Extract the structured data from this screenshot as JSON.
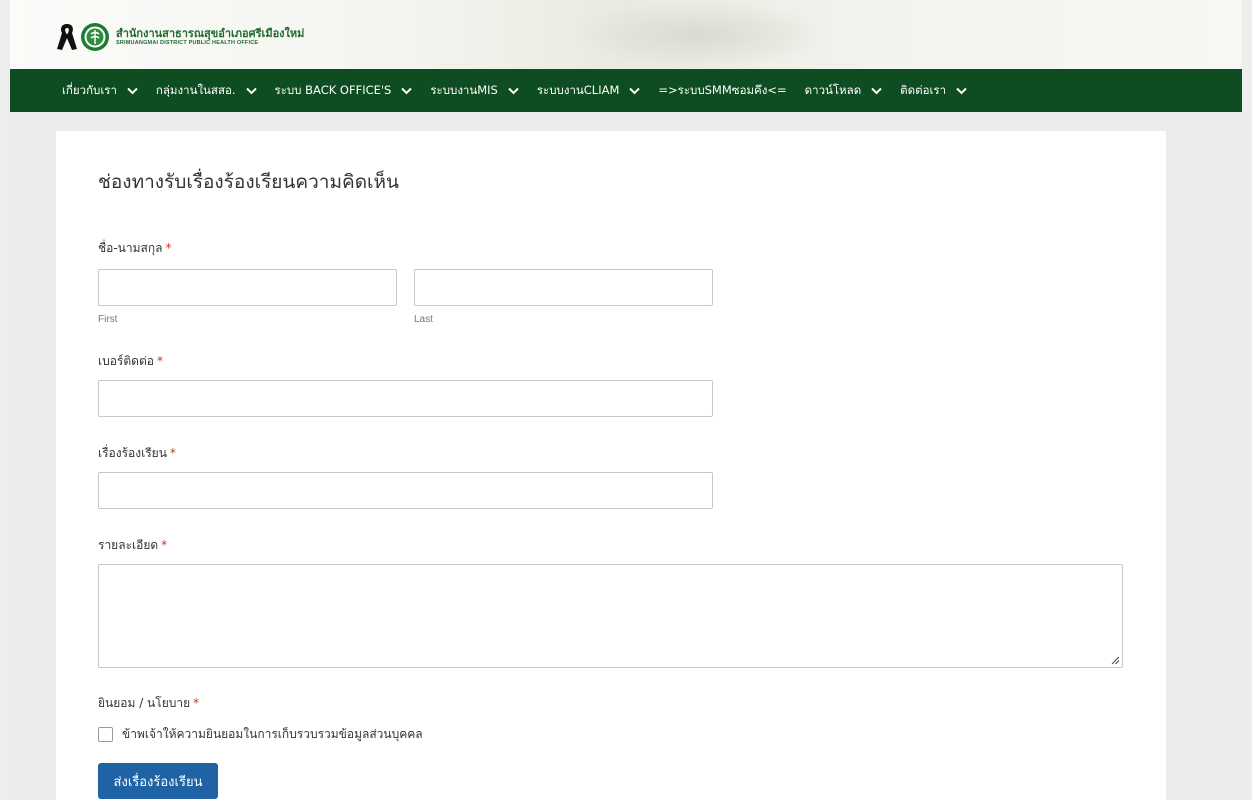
{
  "header": {
    "org_name_th": "สำนักงานสาธารณสุขอำเภอศรีเมืองใหม่",
    "org_name_en": "SRIMUANGMAI DISTRICT PUBLIC HEALTH OFFICE"
  },
  "nav": {
    "items": [
      {
        "label": "เกี่ยวกับเรา",
        "has_dropdown": true
      },
      {
        "label": "กลุ่มงานในสสอ.",
        "has_dropdown": true
      },
      {
        "label": "ระบบ BACK OFFICE'S",
        "has_dropdown": true
      },
      {
        "label": "ระบบงานMIS",
        "has_dropdown": true
      },
      {
        "label": "ระบบงานCLIAM",
        "has_dropdown": true
      },
      {
        "label": "=>ระบบSMMซอมคึง<=",
        "has_dropdown": false
      },
      {
        "label": "ดาวน์โหลด",
        "has_dropdown": true
      },
      {
        "label": "ติดต่อเรา",
        "has_dropdown": true
      }
    ]
  },
  "form": {
    "title": "ช่องทางรับเรื่องร้องเรียนความคิดเห็น",
    "required_mark": "*",
    "name": {
      "label": "ชื่อ-นามสกุล",
      "first_value": "",
      "last_value": "",
      "first_sublabel": "First",
      "last_sublabel": "Last"
    },
    "phone": {
      "label": "เบอร์ติดต่อ",
      "value": ""
    },
    "subject": {
      "label": "เรื่องร้องเรียน",
      "value": ""
    },
    "details": {
      "label": "รายละเอียด",
      "value": ""
    },
    "consent": {
      "label": "ยินยอม / นโยบาย",
      "checkbox_label": "ข้าพเจ้าให้ความยินยอมในการเก็บรวบรวมข้อมูลส่วนบุคคล",
      "checked": false
    },
    "submit_label": "ส่งเรื่องร้องเรียน"
  },
  "colors": {
    "nav_bg": "#0e4d22",
    "brand_green": "#1f6b2e",
    "button_blue": "#1f63a6",
    "required_red": "#c0392b"
  }
}
